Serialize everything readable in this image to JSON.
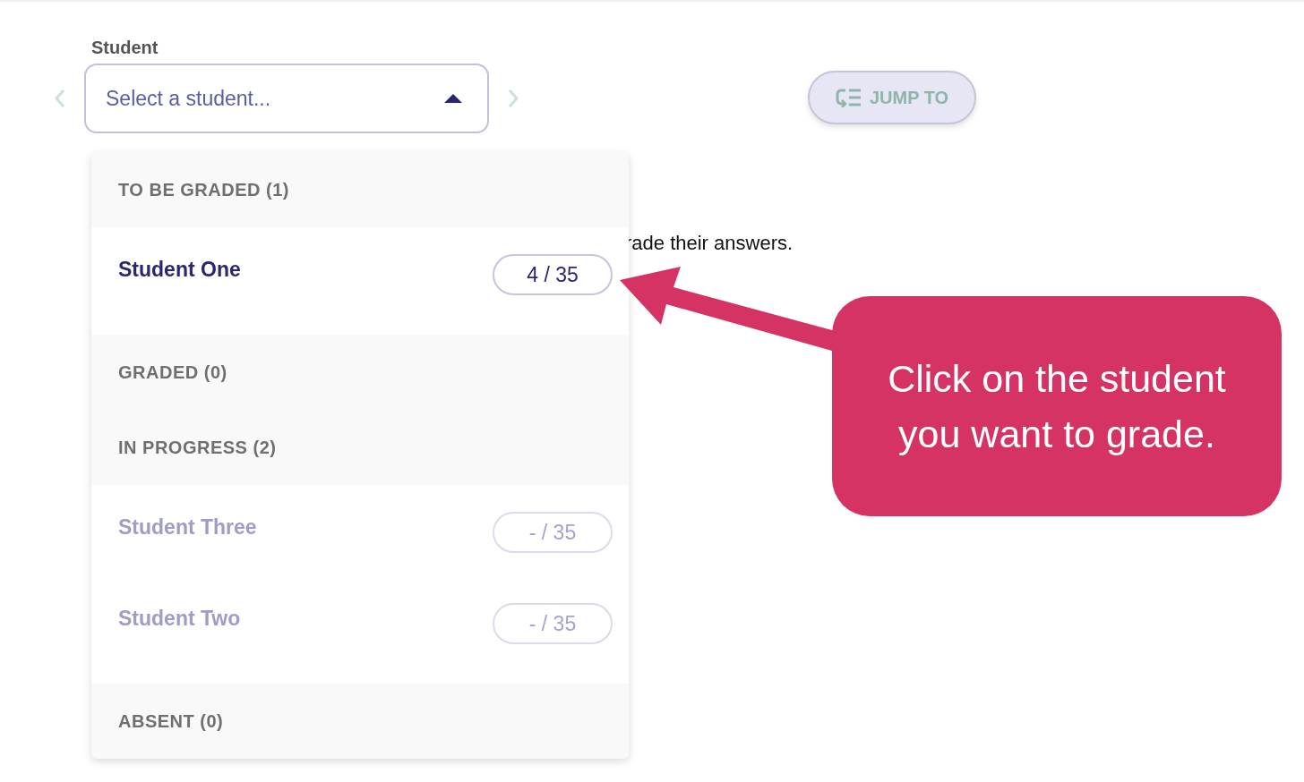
{
  "student_picker": {
    "label": "Student",
    "placeholder": "Select a student...",
    "expanded": true
  },
  "jump_to": {
    "label": "JUMP TO"
  },
  "background_text": "rade their answers.",
  "groups": [
    {
      "heading": "TO BE GRADED (1)",
      "students": [
        {
          "name": "Student One",
          "score": "4 / 35",
          "dimmed": false
        }
      ]
    },
    {
      "heading": "GRADED (0)"
    },
    {
      "heading": "IN PROGRESS (2)",
      "students": [
        {
          "name": "Student Three",
          "score": "- / 35",
          "dimmed": true
        },
        {
          "name": "Student Two",
          "score": "- / 35",
          "dimmed": true
        }
      ]
    },
    {
      "heading": "ABSENT (0)"
    }
  ],
  "callout": {
    "text": "Click on the student you want to grade."
  }
}
